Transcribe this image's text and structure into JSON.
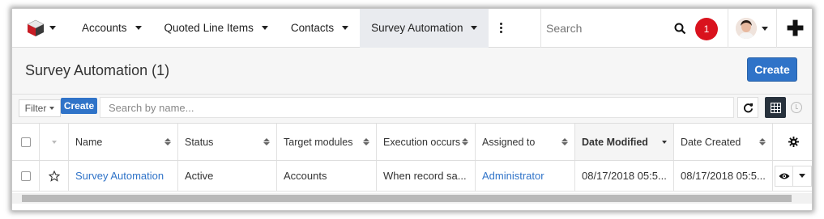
{
  "nav": {
    "tabs": [
      {
        "label": "Accounts"
      },
      {
        "label": "Quoted Line Items"
      },
      {
        "label": "Contacts"
      },
      {
        "label": "Survey Automation"
      }
    ],
    "search_placeholder": "Search",
    "notification_count": "1"
  },
  "header": {
    "title": "Survey Automation (1)",
    "create_label": "Create"
  },
  "filterbar": {
    "filter_label": "Filter",
    "create_label": "Create",
    "search_placeholder": "Search by name..."
  },
  "table": {
    "columns": [
      {
        "label": "Name"
      },
      {
        "label": "Status"
      },
      {
        "label": "Target modules"
      },
      {
        "label": "Execution occurs"
      },
      {
        "label": "Assigned to"
      },
      {
        "label": "Date Modified"
      },
      {
        "label": "Date Created"
      }
    ],
    "rows": [
      {
        "name": "Survey Automation",
        "status": "Active",
        "target_modules": "Accounts",
        "execution_occurs": "When record sa...",
        "assigned_to": "Administrator",
        "date_modified": "08/17/2018 05:5...",
        "date_created": "08/17/2018 05:5..."
      }
    ]
  },
  "colors": {
    "accent": "#2f73c8",
    "notification": "#d9121d",
    "active_tab_bg": "#e9ebef"
  }
}
